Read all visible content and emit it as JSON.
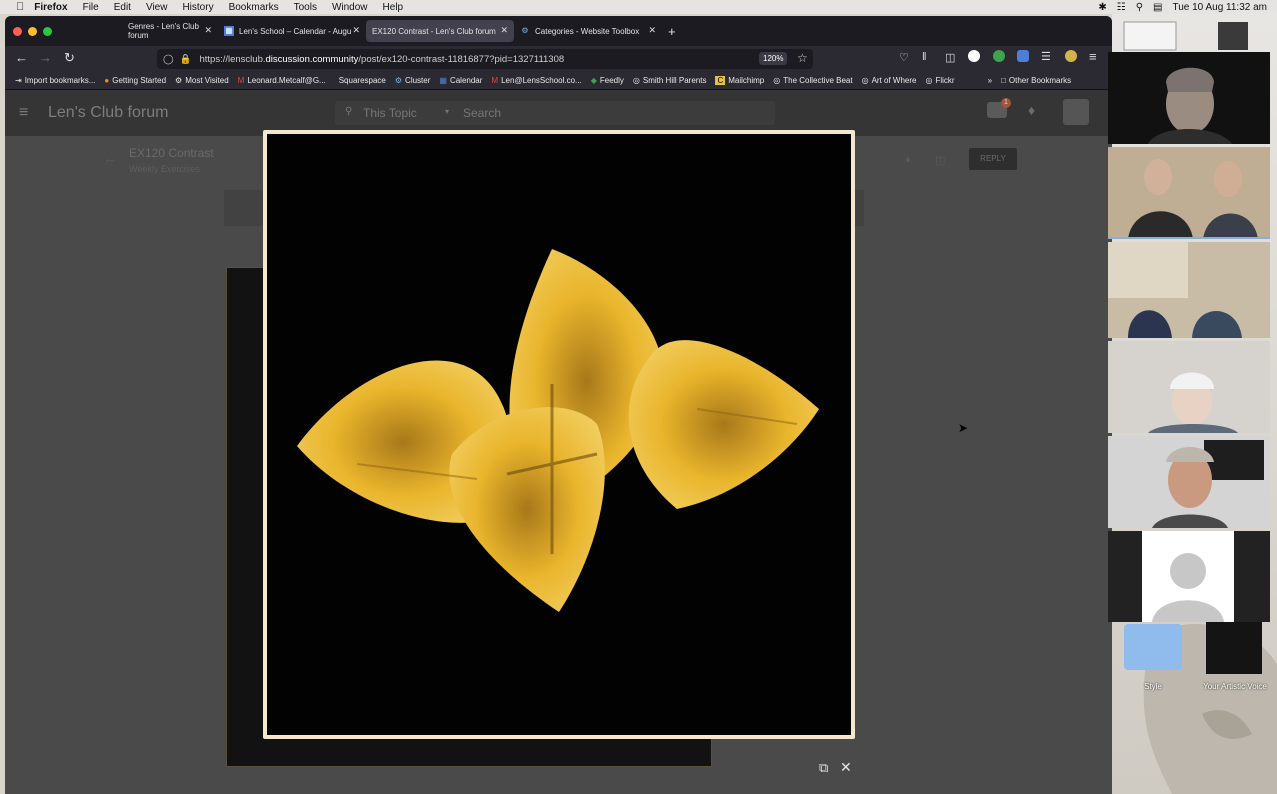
{
  "menubar": {
    "apple_icon": "apple-icon",
    "items": [
      "Firefox",
      "File",
      "Edit",
      "View",
      "History",
      "Bookmarks",
      "Tools",
      "Window",
      "Help"
    ],
    "clock": "Tue 10 Aug  11:32 am"
  },
  "tabs": [
    {
      "label": "Genres - Len's Club forum",
      "active": false
    },
    {
      "label": "Len's School – Calendar - Augu",
      "active": false
    },
    {
      "label": "EX120 Contrast - Len's Club forum",
      "active": true
    },
    {
      "label": "Categories - Website Toolbox",
      "active": false
    }
  ],
  "new_tab": "+",
  "url": {
    "prefix": "https://lensclub.",
    "domain": "discussion.community",
    "path": "/post/ex120-contrast-11816877?pid=1327111308"
  },
  "zoom": "120%",
  "bookmarks": [
    "Import bookmarks...",
    "Getting Started",
    "Most Visited",
    "Leonard.Metcalf@G...",
    "Squarespace",
    "Cluster",
    "Calendar",
    "Len@LensSchool.co...",
    "Feedly",
    "Smith Hill Parents",
    "Mailchimp",
    "The Collective Beat",
    "Art of Where",
    "Flickr"
  ],
  "bookmarks_overflow": "»",
  "other_bookmarks": "Other Bookmarks",
  "forum": {
    "title": "Len's Club forum",
    "search_scope": "This Topic",
    "search_placeholder": "Search",
    "topic_title": "EX120 Contrast",
    "topic_category": "Weekly Exercises",
    "reply_label": "REPLY",
    "notif_count": "1"
  },
  "modal": {
    "open_icon": "external-link-icon",
    "close_icon": "close-icon"
  },
  "desktop": {
    "folder_label": "Style",
    "file_label": "Your Artistic Voice"
  },
  "colors": {
    "accent": "#7fb0e8",
    "petal": "#e8b62a",
    "frame": "#f3e7cf"
  }
}
